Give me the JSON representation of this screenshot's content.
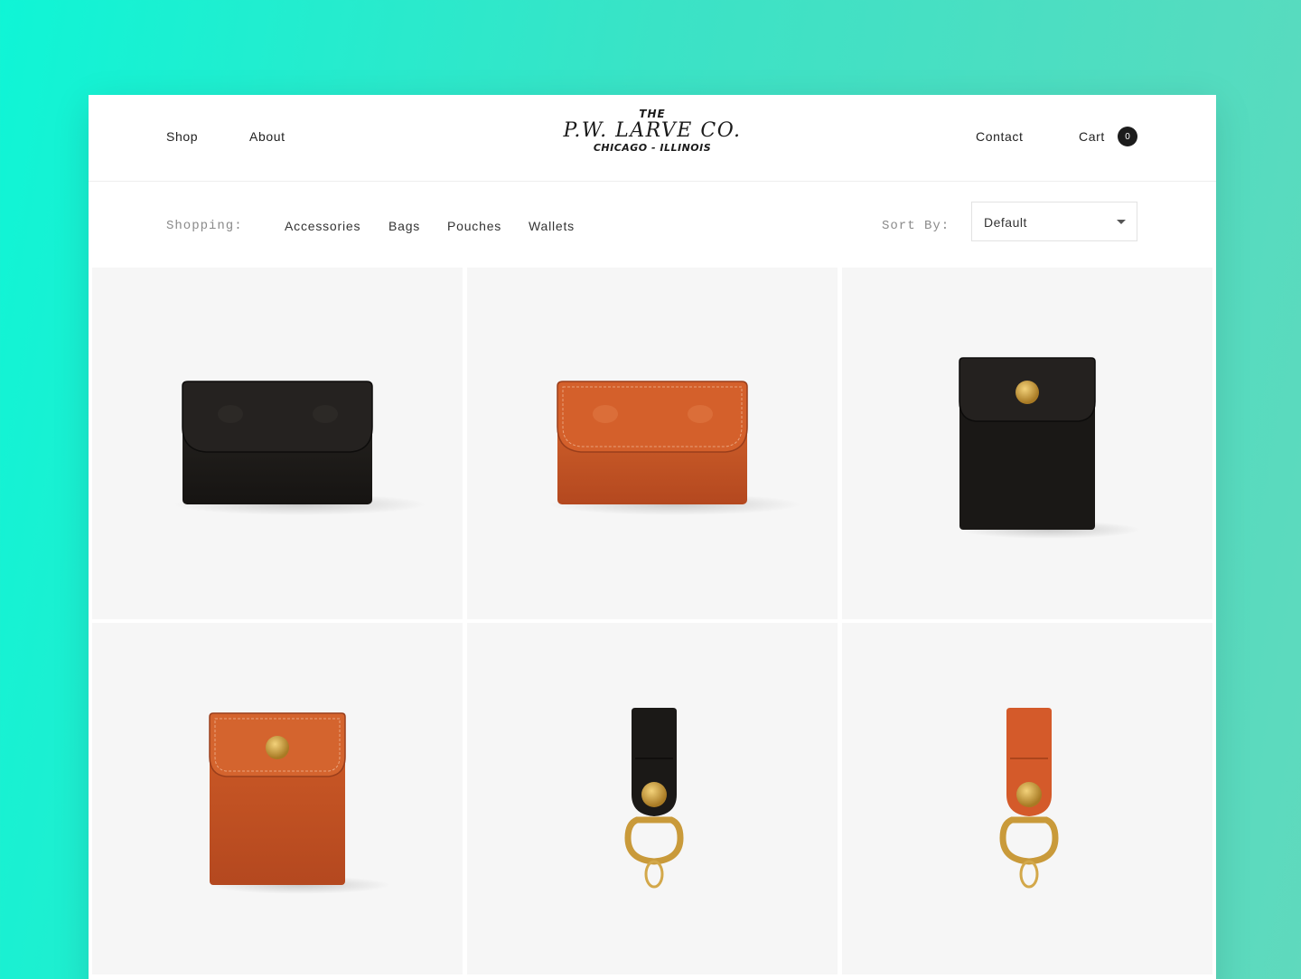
{
  "header": {
    "nav_left": [
      "Shop",
      "About"
    ],
    "logo": {
      "line1": "THE",
      "line2": "P.W. LARVE CO.",
      "line3": "CHICAGO - ILLINOIS"
    },
    "contact": "Contact",
    "cart_label": "Cart",
    "cart_count": "0"
  },
  "filter": {
    "shopping_label": "Shopping:",
    "categories": [
      "Accessories",
      "Bags",
      "Pouches",
      "Wallets"
    ],
    "sort_label": "Sort By:",
    "sort_value": "Default"
  },
  "products": [
    {
      "name": "wallet-black",
      "color": "#1b1917"
    },
    {
      "name": "wallet-tan",
      "color": "#c9562a"
    },
    {
      "name": "card-pouch-black",
      "color": "#1b1917"
    },
    {
      "name": "card-pouch-tan",
      "color": "#c9562a"
    },
    {
      "name": "key-fob-black",
      "color": "#1b1917"
    },
    {
      "name": "key-fob-tan",
      "color": "#d45a2a"
    }
  ],
  "colors": {
    "accent_bg": "#3ae3c6",
    "brass": "#c9a24a",
    "tile_bg": "#f6f6f6"
  }
}
